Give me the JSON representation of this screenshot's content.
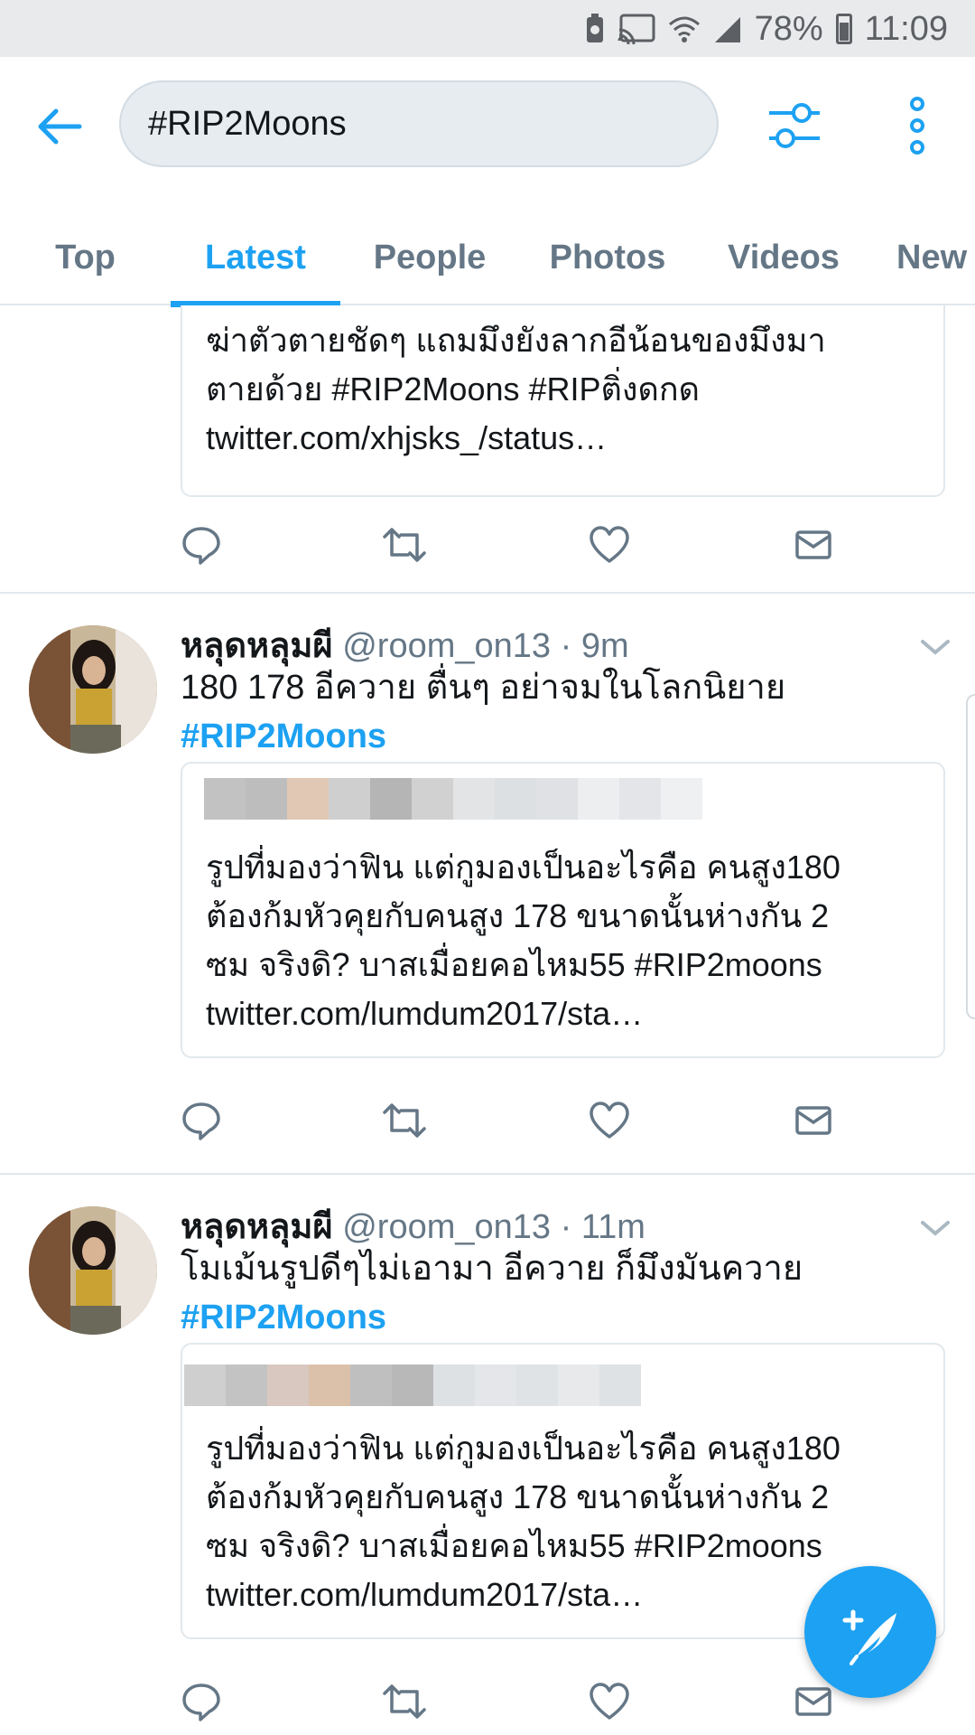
{
  "status_bar": {
    "battery": "78%",
    "time": "11:09"
  },
  "header": {
    "search_value": "#RIP2Moons",
    "tabs": [
      {
        "label": "Top",
        "active": false
      },
      {
        "label": "Latest",
        "active": true
      },
      {
        "label": "People",
        "active": false
      },
      {
        "label": "Photos",
        "active": false
      },
      {
        "label": "Videos",
        "active": false
      },
      {
        "label": "New",
        "active": false
      }
    ]
  },
  "feed": {
    "partial_quote": {
      "line1": "ฆ่าตัวตายชัดๆ แถมมึงยังลากอีน้อนของมึงมา",
      "line2": "ตายด้วย #RIP2Moons #RIPติ่งดกด",
      "line3": "twitter.com/xhjsks_/status…"
    },
    "tweets": [
      {
        "name": "หลุดหลุมผี",
        "handle": "@room_on13",
        "time": "9m",
        "text": "180 178 อีควาย ตื่นๆ อย่าจมในโลกนิยาย",
        "hashtag": "#RIP2Moons",
        "quote": {
          "line1": "รูปที่มองว่าฟิน แต่กูมองเป็นอะไรคือ คนสูง180",
          "line2": "ต้องก้มหัวคุยกับคนสูง 178 ขนาดนั้นห่างกัน 2",
          "line3": "ซม จริงดิ? บาสเมื่อยคอไหม55 #RIP2moons",
          "line4": "twitter.com/lumdum2017/sta…"
        }
      },
      {
        "name": "หลุดหลุมผี",
        "handle": "@room_on13",
        "time": "11m",
        "text": "โมเม้นรูปดีๆไม่เอามา อีควาย ก็มึงมันควาย",
        "hashtag": "#RIP2Moons",
        "quote": {
          "line1": "รูปที่มองว่าฟิน แต่กูมองเป็นอะไรคือ คนสูง180",
          "line2": "ต้องก้มหัวคุยกับคนสูง 178 ขนาดนั้นห่างกัน 2",
          "line3": "ซม จริงดิ? บาสเมื่อยคอไหม55 #RIP2moons",
          "line4": "twitter.com/lumdum2017/sta…"
        }
      }
    ]
  },
  "colors": {
    "accent": "#1da1f2",
    "muted_text": "#657786",
    "icon_gray": "#657786",
    "divider": "#e1e8ed"
  },
  "icons": {
    "back": "arrow-left-icon",
    "filter": "sliders-icon",
    "more": "vertical-dots-icon",
    "reply": "reply-icon",
    "retweet": "retweet-icon",
    "like": "heart-icon",
    "dm": "envelope-icon",
    "compose": "compose-feather-icon"
  }
}
